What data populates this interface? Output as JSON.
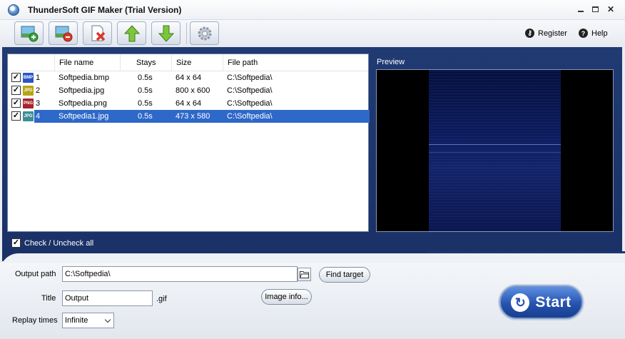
{
  "window": {
    "title": "ThunderSoft GIF Maker (Trial Version)",
    "controls": {
      "minimize": "—",
      "maximize": "□",
      "close": "✕"
    }
  },
  "toolbar": {
    "buttons": [
      {
        "icon": "add-image-icon"
      },
      {
        "icon": "remove-image-icon"
      },
      {
        "icon": "clear-list-icon"
      },
      {
        "icon": "move-up-icon"
      },
      {
        "icon": "move-down-icon"
      },
      {
        "icon": "settings-gear-icon"
      }
    ],
    "register_label": "Register",
    "help_label": "Help"
  },
  "file_list": {
    "columns": [
      "File name",
      "Stays",
      "Size",
      "File path"
    ],
    "rows": [
      {
        "index": "1",
        "type": "BMP",
        "type_color": "#2b55c7",
        "checked": true,
        "file_name": "Softpedia.bmp",
        "stays": "0.5s",
        "size": "64 x 64",
        "path": "C:\\Softpedia\\"
      },
      {
        "index": "2",
        "type": "JPG",
        "type_color": "#b8a316",
        "checked": true,
        "file_name": "Softpedia.jpg",
        "stays": "0.5s",
        "size": "800 x 600",
        "path": "C:\\Softpedia\\"
      },
      {
        "index": "3",
        "type": "PNG",
        "type_color": "#a8242a",
        "checked": true,
        "file_name": "Softpedia.png",
        "stays": "0.5s",
        "size": "64 x 64",
        "path": "C:\\Softpedia\\"
      },
      {
        "index": "4",
        "type": "JPG",
        "type_color": "#3b8e97",
        "checked": true,
        "selected": true,
        "file_name": "Softpedia1.jpg",
        "stays": "0.5s",
        "size": "473 x 580",
        "path": "C:\\Softpedia\\"
      }
    ]
  },
  "preview": {
    "label": "Preview"
  },
  "check_all": {
    "label": "Check / Uncheck all",
    "checked": true
  },
  "output": {
    "path_label": "Output path",
    "path_value": "C:\\Softpedia\\",
    "find_target_label": "Find target",
    "title_label": "Title",
    "title_value": "Output",
    "extension": ".gif",
    "image_info_label": "Image info...",
    "replay_label": "Replay times",
    "replay_value": "Infinite"
  },
  "start": {
    "label": "Start"
  },
  "colors": {
    "panel_bg": "#1f3870",
    "selection": "#2e68c8",
    "start_button": "#2653b0"
  }
}
